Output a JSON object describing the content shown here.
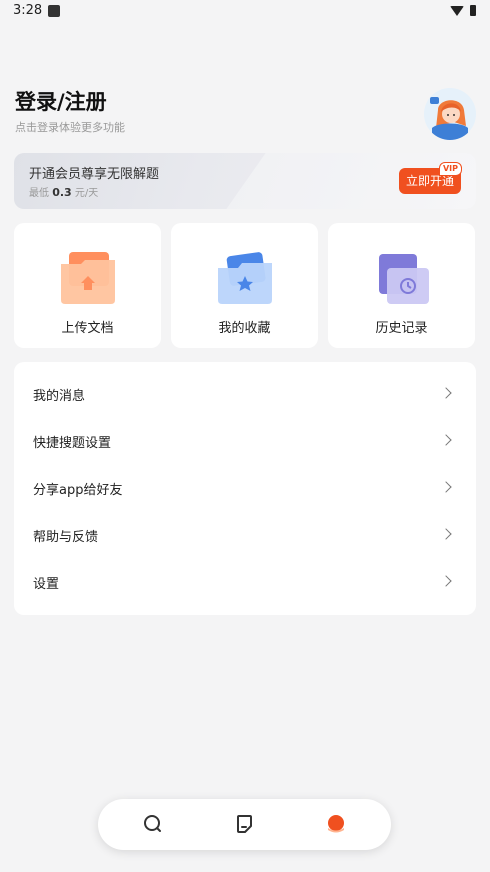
{
  "status_bar": {
    "time": "3:28"
  },
  "account": {
    "title": "登录/注册",
    "subtitle": "点击登录体验更多功能"
  },
  "vip": {
    "title": "开通会员尊享无限解题",
    "price_prefix": "最低",
    "price_value": "0.3",
    "price_unit": "元/天",
    "button_label": "立即开通",
    "badge": "VIP"
  },
  "quick_cards": [
    {
      "label": "上传文档",
      "icon": "upload-folder-icon"
    },
    {
      "label": "我的收藏",
      "icon": "favorites-folder-icon"
    },
    {
      "label": "历史记录",
      "icon": "history-folder-icon"
    }
  ],
  "menu": [
    {
      "label": "我的消息"
    },
    {
      "label": "快捷搜题设置"
    },
    {
      "label": "分享app给好友"
    },
    {
      "label": "帮助与反馈"
    },
    {
      "label": "设置"
    }
  ],
  "tabbar": [
    {
      "icon": "search-icon",
      "active": false
    },
    {
      "icon": "notes-icon",
      "active": false
    },
    {
      "icon": "profile-icon",
      "active": true
    }
  ],
  "colors": {
    "accent": "#f0501f",
    "background": "#f4f4f5"
  }
}
